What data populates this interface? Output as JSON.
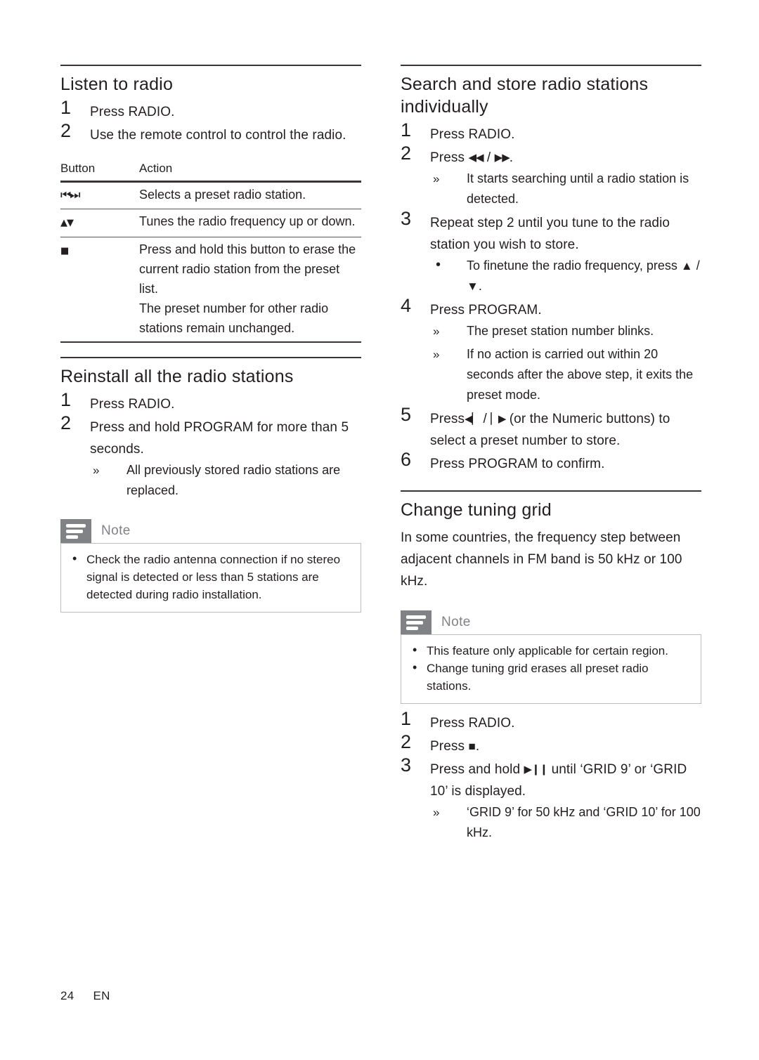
{
  "colors": {
    "text": "#231f20",
    "rule": "#3c3336",
    "note_icon_bg": "#808285",
    "note_label": "#808285",
    "note_border": "#bcbec0"
  },
  "footer": {
    "page_number": "24",
    "language": "EN"
  },
  "note_label": "Note",
  "left_column": {
    "section_listen": {
      "heading": "Listen to radio",
      "steps": [
        {
          "num": "1",
          "text": "Press RADIO."
        },
        {
          "num": "2",
          "text": "Use the remote control to control the radio."
        }
      ],
      "table": {
        "headers": [
          "Button",
          "Action"
        ],
        "rows": [
          {
            "button_icon": "prev-next-track-icon",
            "button_glyph": "⏮⏭",
            "actions": [
              "Selects a preset radio station."
            ]
          },
          {
            "button_icon": "up-down-triangle-icon",
            "button_glyph": "▲▼",
            "actions": [
              "Tunes the radio frequency up or down."
            ]
          },
          {
            "button_icon": "stop-square-icon",
            "button_glyph": "■",
            "actions": [
              "Press and hold this button to erase the current radio station from the preset list.",
              "The preset number for other radio stations remain unchanged."
            ]
          }
        ]
      }
    },
    "section_reinstall": {
      "heading": "Reinstall all the radio stations",
      "steps": [
        {
          "num": "1",
          "text": "Press RADIO."
        },
        {
          "num": "2",
          "text": "Press and hold PROGRAM for more than 5 seconds."
        }
      ],
      "result_bullets": [
        {
          "marker": "»",
          "text": "All previously stored radio stations are replaced."
        }
      ],
      "note": {
        "label": "Note",
        "bullets": [
          {
            "marker": "•",
            "text": "Check the radio antenna connection if no stereo signal is detected or less than 5 stations are detected during radio installation."
          }
        ]
      }
    }
  },
  "right_column": {
    "section_search": {
      "heading": "Search and store radio stations individually",
      "step1": {
        "num": "1",
        "text": "Press RADIO."
      },
      "step2": {
        "num": "2",
        "prefix": "Press ",
        "glyph_rewind": "◀◀",
        "separator": " / ",
        "glyph_forward": "▶▶",
        "suffix": ".",
        "bullets": [
          {
            "marker": "»",
            "text": "It starts searching until a radio station is detected."
          }
        ]
      },
      "step3": {
        "num": "3",
        "text": "Repeat step 2 until you tune to the radio station you wish to store.",
        "bullet_marker": "•",
        "bullet_prefix": "To finetune the radio frequency, press ",
        "bullet_glyph_up": "▲",
        "bullet_separator": " / ",
        "bullet_glyph_down": "▼",
        "bullet_suffix": "."
      },
      "step4": {
        "num": "4",
        "text": "Press PROGRAM.",
        "bullets": [
          {
            "marker": "»",
            "text": "The preset station number blinks."
          },
          {
            "marker": "»",
            "text": "If no action is carried out within 20 seconds after the above step, it exits the preset mode."
          }
        ]
      },
      "step5": {
        "num": "5",
        "prefix": "Press",
        "glyph_prev": "◀▏",
        "separator": " / ",
        "glyph_next": "▏▶",
        "suffix": " (or the Numeric buttons) to select a preset number to store."
      },
      "step6": {
        "num": "6",
        "text": "Press PROGRAM to confirm."
      }
    },
    "section_grid": {
      "heading": "Change tuning grid",
      "intro": "In some countries, the frequency step between adjacent channels in FM band is 50 kHz or 100 kHz.",
      "note": {
        "label": "Note",
        "bullets": [
          {
            "marker": "•",
            "text": "This feature only applicable for certain region."
          },
          {
            "marker": "•",
            "text": "Change tuning grid erases all preset radio stations."
          }
        ]
      },
      "step1": {
        "num": "1",
        "text": "Press RADIO."
      },
      "step2": {
        "num": "2",
        "prefix": "Press ",
        "glyph_stop": "■",
        "suffix": "."
      },
      "step3": {
        "num": "3",
        "prefix": "Press and hold ",
        "glyph_playpause": "▶❙❙",
        "suffix": " until ‘GRID 9’ or ‘GRID 10’ is displayed.",
        "bullets": [
          {
            "marker": "»",
            "text": "‘GRID 9’ for 50 kHz and ‘GRID 10’ for 100 kHz."
          }
        ]
      }
    }
  }
}
